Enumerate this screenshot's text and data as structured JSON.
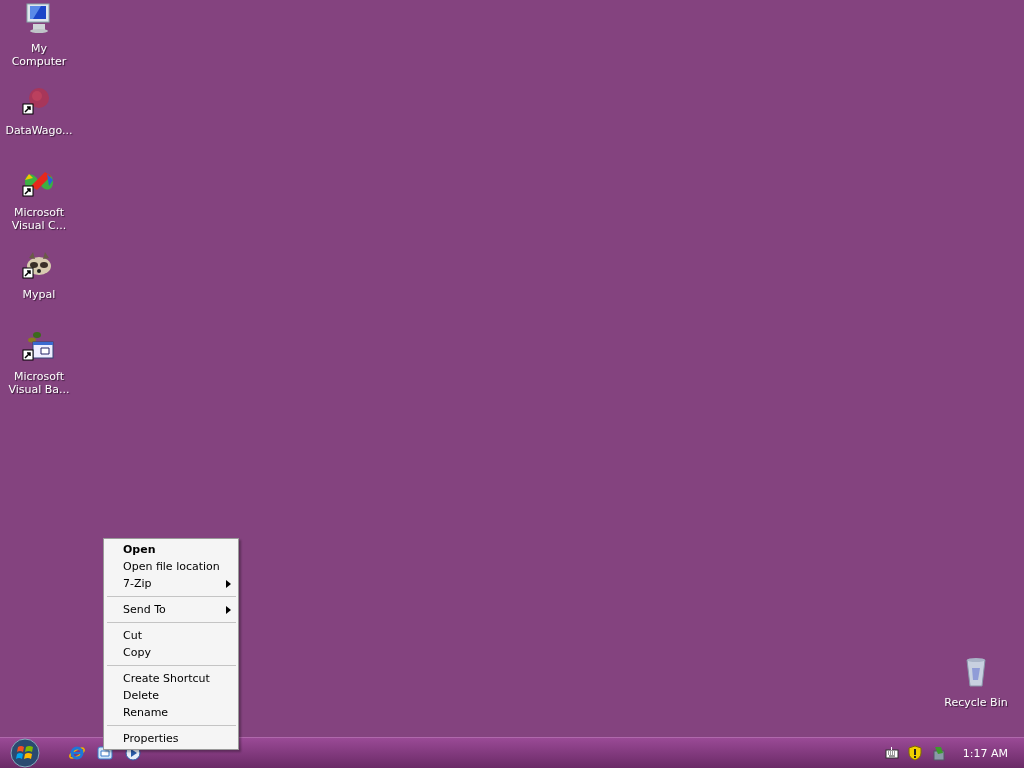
{
  "desktop_icons": [
    {
      "label": "My Computer",
      "shortcut": false
    },
    {
      "label": "DataWago...",
      "shortcut": true
    },
    {
      "label": "Microsoft Visual C...",
      "shortcut": true
    },
    {
      "label": "Mypal",
      "shortcut": true
    },
    {
      "label": "Microsoft Visual Ba...",
      "shortcut": true
    }
  ],
  "recycle_bin": {
    "label": "Recycle Bin"
  },
  "context_menu": {
    "items": [
      {
        "kind": "item",
        "label": "Open",
        "default": true,
        "has_submenu": false
      },
      {
        "kind": "item",
        "label": "Open file location",
        "default": false,
        "has_submenu": false
      },
      {
        "kind": "item",
        "label": "7-Zip",
        "default": false,
        "has_submenu": true
      },
      {
        "kind": "separator"
      },
      {
        "kind": "item",
        "label": "Send To",
        "default": false,
        "has_submenu": true
      },
      {
        "kind": "separator"
      },
      {
        "kind": "item",
        "label": "Cut",
        "default": false,
        "has_submenu": false
      },
      {
        "kind": "item",
        "label": "Copy",
        "default": false,
        "has_submenu": false
      },
      {
        "kind": "separator"
      },
      {
        "kind": "item",
        "label": "Create Shortcut",
        "default": false,
        "has_submenu": false
      },
      {
        "kind": "item",
        "label": "Delete",
        "default": false,
        "has_submenu": false
      },
      {
        "kind": "item",
        "label": "Rename",
        "default": false,
        "has_submenu": false
      },
      {
        "kind": "separator"
      },
      {
        "kind": "item",
        "label": "Properties",
        "default": false,
        "has_submenu": false
      }
    ]
  },
  "taskbar": {
    "clock": "1:17 AM"
  }
}
